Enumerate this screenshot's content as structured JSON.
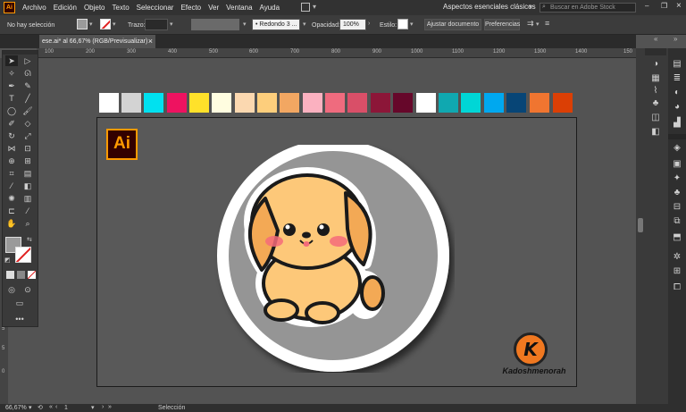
{
  "menubar": {
    "items": [
      "Archivo",
      "Edición",
      "Objeto",
      "Texto",
      "Seleccionar",
      "Efecto",
      "Ver",
      "Ventana",
      "Ayuda"
    ],
    "workspace": "Aspectos esenciales clásicos",
    "search_placeholder": "Buscar en Adobe Stock",
    "app_logo": "Ai"
  },
  "control_bar": {
    "selection_status": "No hay selección",
    "stroke_label": "Trazo:",
    "brush_value": "Redondo 3 ...",
    "opacity_label": "Opacidad:",
    "opacity_value": "100%",
    "style_label": "Estilo:",
    "adjust_doc_button": "Ajustar documento",
    "preferences_button": "Preferencias"
  },
  "tab": {
    "title": "ese.ai* al 66,67% (RGB/Previsualizar)",
    "close": "×"
  },
  "ruler": {
    "top_ticks": [
      "100",
      "200",
      "300",
      "400",
      "500",
      "600",
      "700",
      "800",
      "900",
      "1000",
      "1100",
      "1200",
      "1300",
      "1400",
      "150"
    ],
    "left_ticks": [
      "5",
      "5",
      "0"
    ]
  },
  "swatches": [
    "#ffffff",
    "#d3d3d3",
    "#00e1f0",
    "#ee1260",
    "#ffe12a",
    "#fffde0",
    "#fbd8b0",
    "#fdce7c",
    "#f2a762",
    "#fbb1c0",
    "#ef6b7e",
    "#d94f68",
    "#8c1638",
    "#66072a",
    "#ffffff",
    "#10a8b0",
    "#00d6d6",
    "#00a8ef",
    "#074576",
    "#f07530",
    "#db3f05"
  ],
  "artboard": {
    "ai_badge": "Ai",
    "brand_letter": "K",
    "brand_name": "Kadoshmenorah"
  },
  "colors": {
    "accent": "#ff9a00",
    "dog_fur": "#fdc879",
    "dog_fur_shade": "#f3a955",
    "blush": "#f46b7a",
    "circle_fill": "#959595"
  },
  "statusbar": {
    "zoom": "66,67%",
    "page": "1",
    "status": "Selección"
  }
}
